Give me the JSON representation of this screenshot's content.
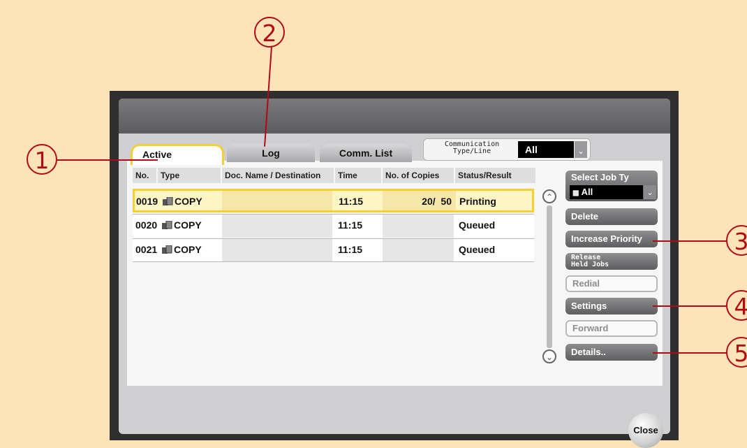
{
  "callouts": [
    "1",
    "2",
    "3",
    "4",
    "5"
  ],
  "tabs": {
    "active": "Active",
    "log": "Log",
    "comm_list": "Comm. List"
  },
  "comm_filter": {
    "label": "Communication\nType/Line",
    "value": "All"
  },
  "table": {
    "columns": [
      "No.",
      "Type",
      "Doc. Name / Destination",
      "Time",
      "No. of Copies",
      "Status/Result"
    ],
    "rows": [
      {
        "no": "0019",
        "type": "COPY",
        "doc": "",
        "time": "11:15",
        "copies": "20/  50",
        "status": "Printing",
        "selected": true
      },
      {
        "no": "0020",
        "type": "COPY",
        "doc": "",
        "time": "11:15",
        "copies": "",
        "status": "Queued",
        "selected": false
      },
      {
        "no": "0021",
        "type": "COPY",
        "doc": "",
        "time": "11:15",
        "copies": "",
        "status": "Queued",
        "selected": false
      }
    ]
  },
  "side_panel": {
    "select_job_type_label": "Select Job Ty",
    "select_job_type_value": "All",
    "delete": "Delete",
    "increase_priority": "Increase Priority",
    "release_held_jobs": "Release\nHeld Jobs",
    "redial": "Redial",
    "settings": "Settings",
    "forward": "Forward",
    "details": "Details.."
  },
  "close": "Close",
  "colors": {
    "accent_callout": "#b00a14",
    "tab_highlight": "#f4cf36",
    "background": "#fde3b8"
  }
}
